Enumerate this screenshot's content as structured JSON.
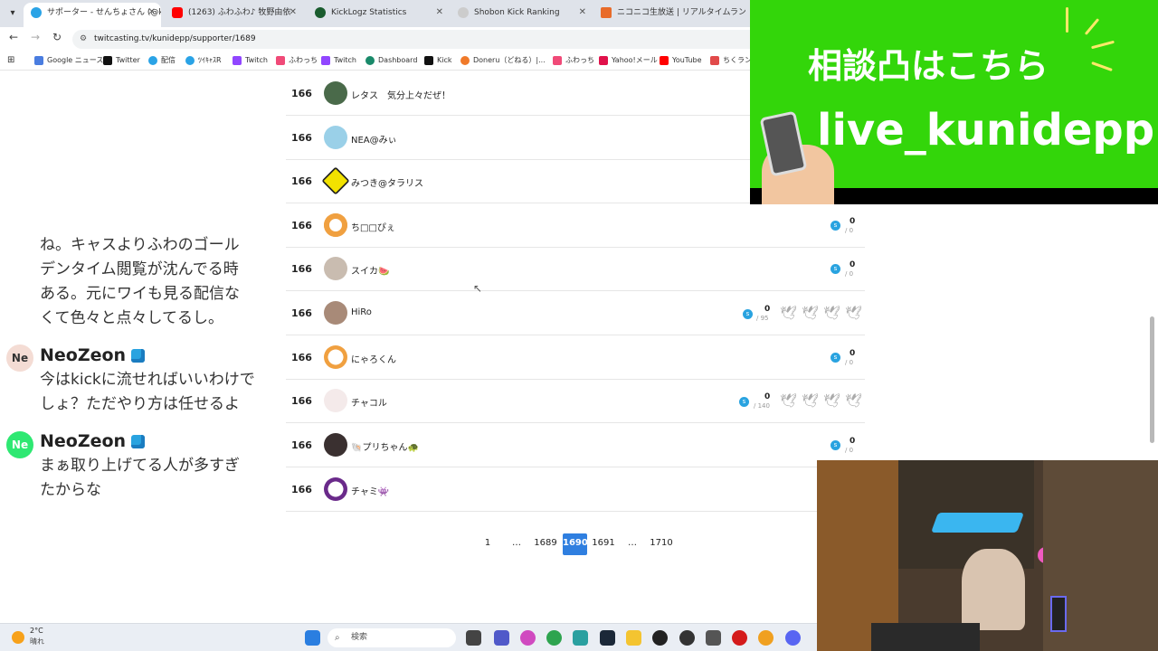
{
  "browser": {
    "tabs": [
      {
        "label": "サポーター - せんちょさん (@kunide",
        "active": true
      },
      {
        "label": "(1263) ふわふわ♪ 牧野由依"
      },
      {
        "label": "KickLogz Statistics"
      },
      {
        "label": "Shobon Kick Ranking"
      },
      {
        "label": "ニコニコ生放送 | リアルタイムランキ"
      }
    ],
    "url": "twitcasting.tv/kunidepp/supporter/1689",
    "bookmarks": [
      "Google ニュース",
      "Twitter",
      "配信",
      "ﾂｲｷｬｽR",
      "Twitch",
      "ふわっち",
      "Twitch",
      "Dashboard",
      "Kick",
      "Doneru（どねる）|...",
      "ふわっち",
      "Yahoo!メール",
      "YouTube",
      "ちくラン"
    ]
  },
  "chat": {
    "fragment_lines": [
      "ね。キャスよりふわのゴール",
      "デンタイム閲覧が沈んでる時",
      "ある。元にワイも見る配信な",
      "くて色々と点々してるし。"
    ],
    "messages": [
      {
        "avatar": "Ne",
        "user": "NeoZeon",
        "lines": [
          "今はkickに流せればいいわけで",
          "しょ？ただやり方は任せるよ"
        ]
      },
      {
        "avatar": "Ne",
        "user": "NeoZeon",
        "lines": [
          "まぁ取り上げてる人が多すぎ",
          "たからな"
        ]
      }
    ]
  },
  "supporters": [
    {
      "rank": "166",
      "name": "レタス　気分上々だぜ！"
    },
    {
      "rank": "166",
      "name": "NEA@みぃ"
    },
    {
      "rank": "166",
      "name": "みつき@タラリス"
    },
    {
      "rank": "166",
      "name": "ち□□ぴぇ",
      "points": "0",
      "max": "/ 0"
    },
    {
      "rank": "166",
      "name": "スイカ🍉",
      "points": "0",
      "max": "/ 0"
    },
    {
      "rank": "166",
      "name": "HiRo",
      "points": "0",
      "max": "/ 95"
    },
    {
      "rank": "166",
      "name": "にゃろくん",
      "points": "0",
      "max": "/ 0"
    },
    {
      "rank": "166",
      "name": "チャコル",
      "points": "0",
      "max": "/ 140"
    },
    {
      "rank": "166",
      "name": "🐚プリちゃん🐢",
      "points": "0",
      "max": "/ 0"
    },
    {
      "rank": "166",
      "name": "チャミ👾"
    }
  ],
  "pagination": {
    "items": [
      "1",
      "…",
      "1689",
      "1690",
      "1691",
      "…",
      "1710"
    ],
    "current": "1690"
  },
  "overlay": {
    "title": "相談凸はこちら",
    "handle": "live_kunidepp"
  },
  "taskbar": {
    "temp": "2°C",
    "weather": "晴れ",
    "search_placeholder": "検索"
  },
  "colors": {
    "accent": "#2f7fe0",
    "overlay_green": "#33d60a",
    "coin": "#29a3e0"
  }
}
